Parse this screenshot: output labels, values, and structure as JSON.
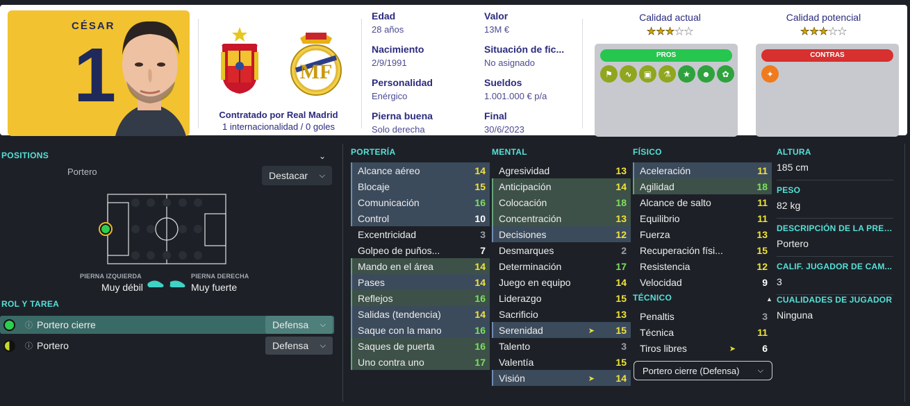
{
  "player": {
    "shirt_name": "CÉSAR",
    "shirt_number": "1",
    "contract_line1": "Contratado por Real Madrid",
    "contract_line2": "1 internacionalidad / 0 goles"
  },
  "info": {
    "col1": [
      {
        "label": "Edad",
        "value": "28 años"
      },
      {
        "label": "Nacimiento",
        "value": "2/9/1991"
      },
      {
        "label": "Personalidad",
        "value": "Enérgico"
      },
      {
        "label": "Pierna buena",
        "value": "Solo derecha"
      }
    ],
    "col2": [
      {
        "label": "Valor",
        "value": "13M €"
      },
      {
        "label": "Situación de fic...",
        "value": "No asignado"
      },
      {
        "label": "Sueldos",
        "value": "1.001.000 € p/a"
      },
      {
        "label": "Final",
        "value": "30/6/2023"
      }
    ]
  },
  "quality": {
    "current_label": "Calidad actual",
    "potential_label": "Calidad potencial",
    "current_stars": 2.5,
    "potential_stars": 2.5
  },
  "pros": {
    "label": "PROS",
    "color": "#26c64f",
    "icons": [
      "flag-icon",
      "wave-icon",
      "pitch-icon",
      "flask-icon",
      "star-icon",
      "head-icon",
      "brain-icon"
    ]
  },
  "contras": {
    "label": "CONTRAS",
    "color": "#d7302e",
    "icons": [
      "foot-icon"
    ]
  },
  "positions": {
    "title": "POSITIONS",
    "position_name": "Portero",
    "highlight_dropdown": "Destacar",
    "left_foot_label": "PIERNA IZQUIERDA",
    "left_foot_value": "Muy débil",
    "right_foot_label": "PIERNA DERECHA",
    "right_foot_value": "Muy fuerte"
  },
  "roles": {
    "title": "ROL Y TAREA",
    "items": [
      {
        "name": "Portero cierre",
        "duty": "Defensa",
        "selected": true
      },
      {
        "name": "Portero",
        "duty": "Defensa",
        "selected": false
      }
    ]
  },
  "attributes": {
    "porteria": {
      "title": "PORTERÍA",
      "rows": [
        {
          "name": "Alcance aéreo",
          "value": "14",
          "color": "yellow",
          "hl": "blue"
        },
        {
          "name": "Blocaje",
          "value": "15",
          "color": "yellow",
          "hl": "blue"
        },
        {
          "name": "Comunicación",
          "value": "16",
          "color": "green",
          "hl": "blue"
        },
        {
          "name": "Control",
          "value": "10",
          "color": "white",
          "hl": "blue"
        },
        {
          "name": "Excentricidad",
          "value": "3",
          "color": "grey",
          "hl": ""
        },
        {
          "name": "Golpeo de puños...",
          "value": "7",
          "color": "white",
          "hl": ""
        },
        {
          "name": "Mando en el área",
          "value": "14",
          "color": "yellow",
          "hl": "green"
        },
        {
          "name": "Pases",
          "value": "14",
          "color": "yellow",
          "hl": "blue"
        },
        {
          "name": "Reflejos",
          "value": "16",
          "color": "green",
          "hl": "green"
        },
        {
          "name": "Salidas (tendencia)",
          "value": "14",
          "color": "yellow",
          "hl": "blue"
        },
        {
          "name": "Saque con la mano",
          "value": "16",
          "color": "green",
          "hl": "blue"
        },
        {
          "name": "Saques de puerta",
          "value": "16",
          "color": "green",
          "hl": "green"
        },
        {
          "name": "Uno contra uno",
          "value": "17",
          "color": "green",
          "hl": "green"
        }
      ]
    },
    "mental": {
      "title": "MENTAL",
      "rows": [
        {
          "name": "Agresividad",
          "value": "13",
          "color": "yellow",
          "hl": ""
        },
        {
          "name": "Anticipación",
          "value": "14",
          "color": "yellow",
          "hl": "green"
        },
        {
          "name": "Colocación",
          "value": "18",
          "color": "green",
          "hl": "green"
        },
        {
          "name": "Concentración",
          "value": "13",
          "color": "yellow",
          "hl": "green"
        },
        {
          "name": "Decisiones",
          "value": "12",
          "color": "yellow",
          "hl": "blue"
        },
        {
          "name": "Desmarques",
          "value": "2",
          "color": "grey",
          "hl": ""
        },
        {
          "name": "Determinación",
          "value": "17",
          "color": "green",
          "hl": ""
        },
        {
          "name": "Juego en equipo",
          "value": "14",
          "color": "yellow",
          "hl": ""
        },
        {
          "name": "Liderazgo",
          "value": "15",
          "color": "yellow",
          "hl": ""
        },
        {
          "name": "Sacrificio",
          "value": "13",
          "color": "yellow",
          "hl": ""
        },
        {
          "name": "Serenidad",
          "value": "15",
          "color": "yellow",
          "hl": "blue",
          "arrow": true
        },
        {
          "name": "Talento",
          "value": "3",
          "color": "grey",
          "hl": ""
        },
        {
          "name": "Valentía",
          "value": "15",
          "color": "yellow",
          "hl": ""
        },
        {
          "name": "Visión",
          "value": "14",
          "color": "yellow",
          "hl": "blue",
          "arrow": true
        }
      ]
    },
    "fisico": {
      "title": "FÍSICO",
      "rows": [
        {
          "name": "Aceleración",
          "value": "11",
          "color": "yellow",
          "hl": "blue"
        },
        {
          "name": "Agilidad",
          "value": "18",
          "color": "green",
          "hl": "green"
        },
        {
          "name": "Alcance de salto",
          "value": "11",
          "color": "yellow",
          "hl": ""
        },
        {
          "name": "Equilibrio",
          "value": "11",
          "color": "yellow",
          "hl": ""
        },
        {
          "name": "Fuerza",
          "value": "13",
          "color": "yellow",
          "hl": ""
        },
        {
          "name": "Recuperación físi...",
          "value": "15",
          "color": "yellow",
          "hl": ""
        },
        {
          "name": "Resistencia",
          "value": "12",
          "color": "yellow",
          "hl": ""
        },
        {
          "name": "Velocidad",
          "value": "9",
          "color": "white",
          "hl": ""
        }
      ]
    },
    "tecnico": {
      "title": "TÉCNICO",
      "rows": [
        {
          "name": "Penaltis",
          "value": "3",
          "color": "grey",
          "hl": ""
        },
        {
          "name": "Técnica",
          "value": "11",
          "color": "yellow",
          "hl": ""
        },
        {
          "name": "Tiros libres",
          "value": "6",
          "color": "white",
          "hl": "",
          "arrow": true
        }
      ],
      "role_dropdown": "Portero cierre (Defensa)"
    }
  },
  "details": [
    {
      "label": "ALTURA",
      "value": "185 cm"
    },
    {
      "label": "PESO",
      "value": "82 kg"
    },
    {
      "label": "DESCRIPCIÓN DE LA PREN...",
      "value": "Portero"
    },
    {
      "label": "CALIF. JUGADOR DE CAM...",
      "value": "3"
    },
    {
      "label": "CUALIDADES DE JUGADOR",
      "value": "Ninguna"
    }
  ]
}
